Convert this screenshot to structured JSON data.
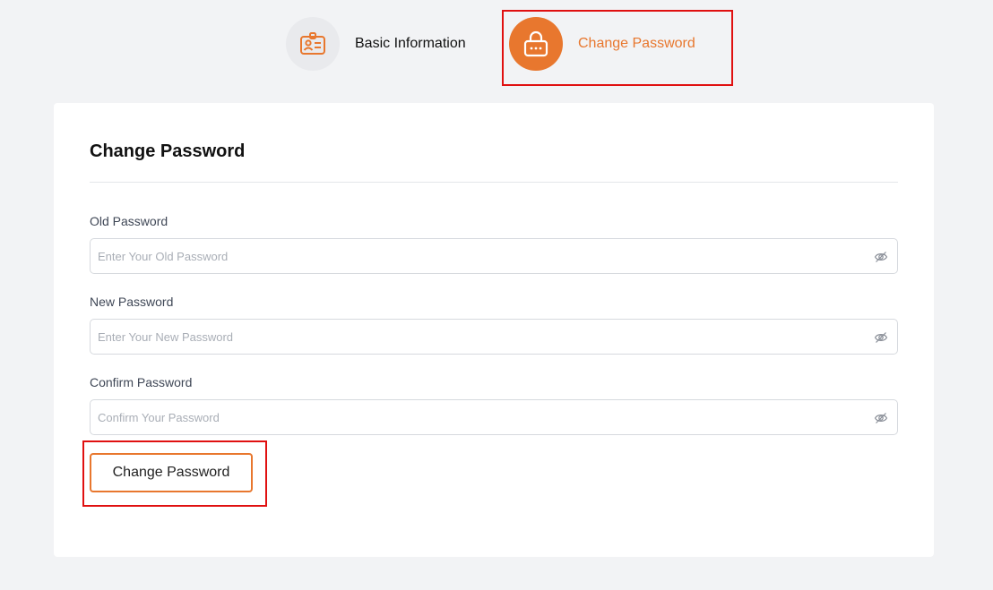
{
  "tabs": {
    "basic_label": "Basic Information",
    "change_label": "Change Password",
    "basic_icon": "id-card-icon",
    "change_icon": "lock-icon",
    "accent_color": "#e8772e"
  },
  "form": {
    "title": "Change Password",
    "old": {
      "label": "Old Password",
      "placeholder": "Enter Your Old Password",
      "value": ""
    },
    "new": {
      "label": "New Password",
      "placeholder": "Enter Your New Password",
      "value": ""
    },
    "confirm": {
      "label": "Confirm Password",
      "placeholder": "Confirm Your Password",
      "value": ""
    },
    "eye_icon": "eye-off-icon",
    "submit_label": "Change Password"
  },
  "highlights": {
    "color": "#e01010"
  }
}
